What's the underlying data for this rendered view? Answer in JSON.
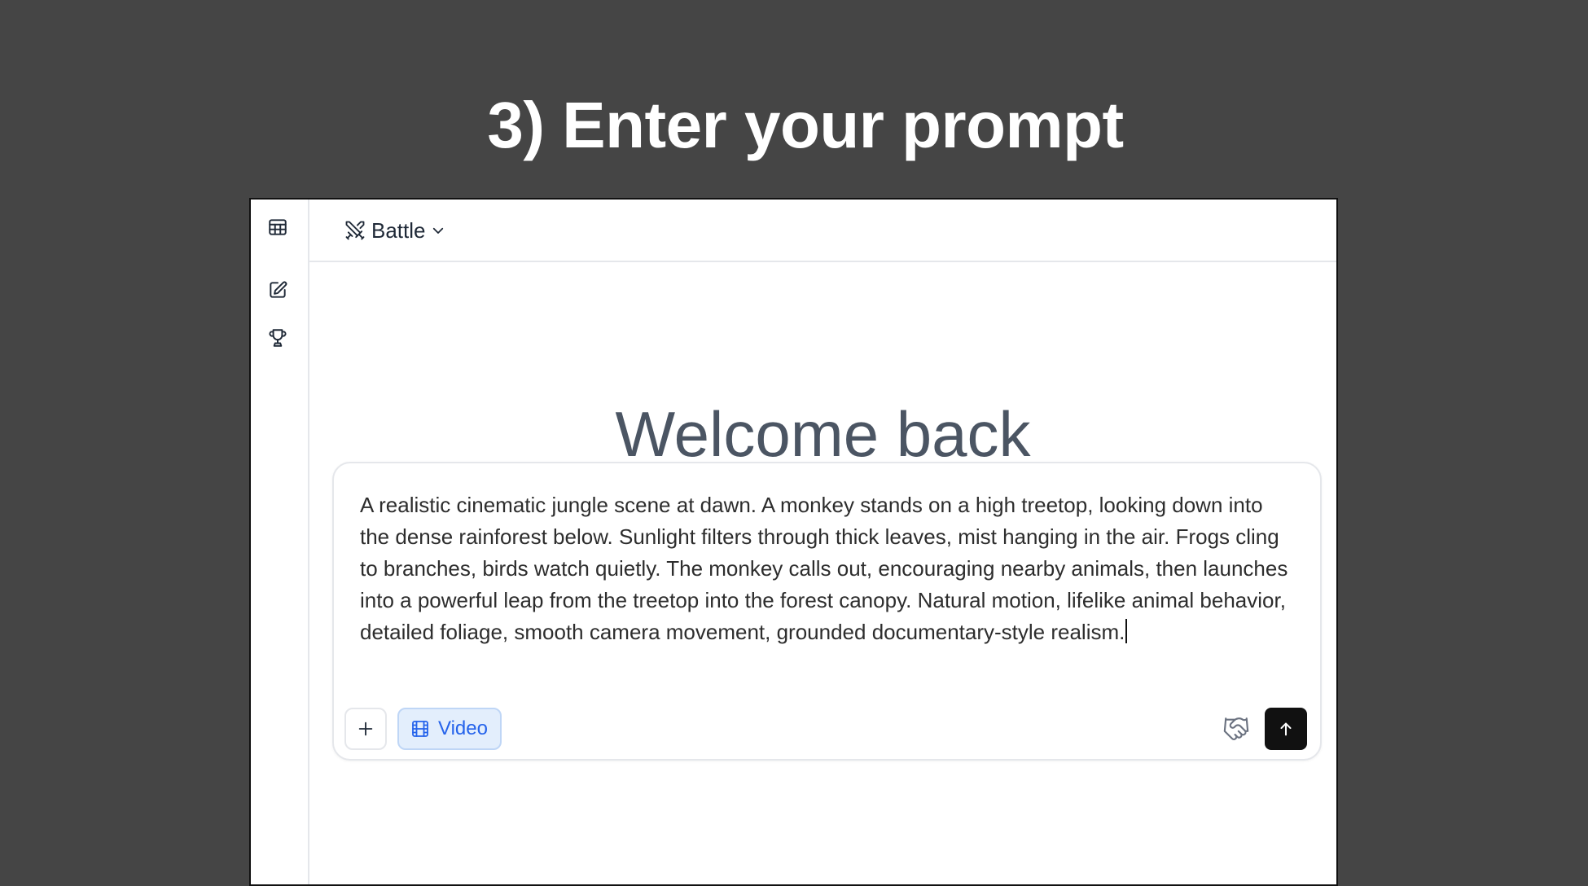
{
  "slide": {
    "title": "3) Enter your prompt"
  },
  "sidebar": {
    "items": [
      {
        "icon": "table-grid-icon"
      },
      {
        "icon": "edit-note-icon"
      },
      {
        "icon": "trophy-icon"
      }
    ]
  },
  "header": {
    "mode_icon": "crossed-swords-icon",
    "mode_label": "Battle",
    "chevron_icon": "chevron-down-icon"
  },
  "main": {
    "welcome": "Welcome back"
  },
  "composer": {
    "prompt_value": "A realistic cinematic jungle scene at dawn. A monkey stands on a high treetop, looking down into the dense rainforest below. Sunlight filters through thick leaves, mist hanging in the air. Frogs cling to branches, birds watch quietly. The monkey calls out, encouraging nearby animals, then launches into a powerful leap from the treetop into the forest canopy. Natural motion, lifelike animal behavior, detailed foliage, smooth camera movement, grounded documentary-style realism.",
    "add_icon": "plus-icon",
    "video_chip": {
      "icon": "film-icon",
      "label": "Video"
    },
    "handshake_icon": "handshake-icon",
    "send_icon": "arrow-up-icon"
  },
  "colors": {
    "background": "#454545",
    "accent": "#2563eb",
    "chip_bg": "#e3eefc",
    "send_bg": "#111111"
  }
}
